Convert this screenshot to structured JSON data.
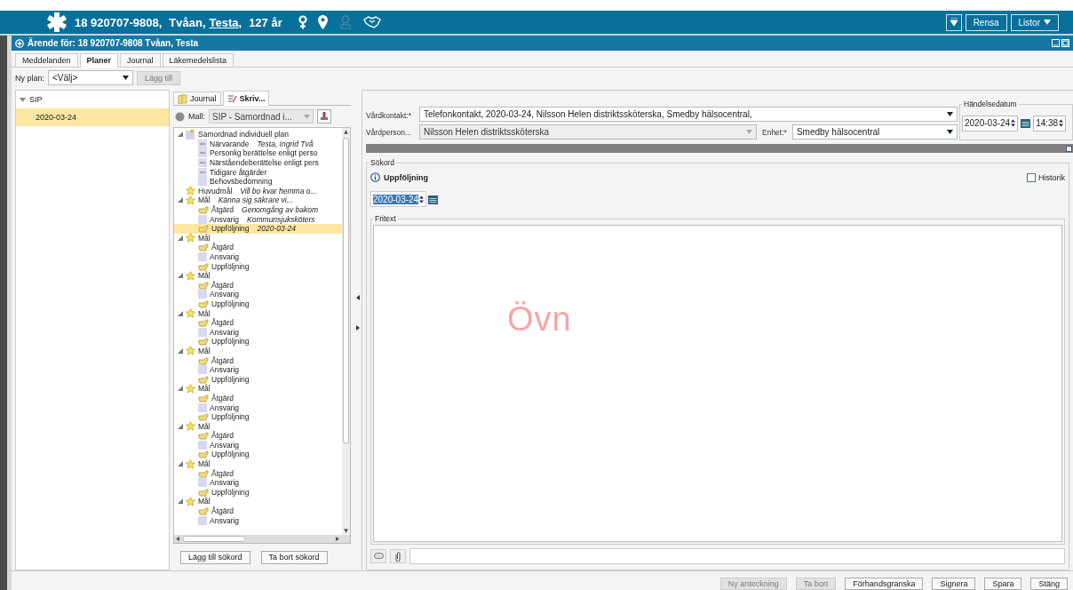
{
  "patient": {
    "id": "18 920707-9808,",
    "surname": "Tvåan,",
    "first_name": "Testa",
    "separator": ",",
    "age": "127 år"
  },
  "header_buttons": [
    {
      "label": "Rensa",
      "kind": "plain"
    },
    {
      "label": "Listor",
      "kind": "menu"
    }
  ],
  "window": {
    "title": "Ärende för: 18 920707-9808 Tvåan, Testa"
  },
  "tabs": [
    {
      "label": "Meddelanden",
      "selected": false
    },
    {
      "label": "Planer",
      "selected": true
    },
    {
      "label": "Journal",
      "selected": false
    },
    {
      "label": "Läkemedelslista",
      "selected": false
    }
  ],
  "new_plan": {
    "label": "Ny plan:",
    "value": "<Välj>",
    "button": "Lägg till",
    "button_disabled": true
  },
  "plans": [
    {
      "label": "SIP",
      "expanded": true,
      "children": [
        {
          "label": "2020-03-24",
          "selected": true
        }
      ]
    }
  ],
  "subtabs": [
    {
      "label": "Journal",
      "kind": "book",
      "selected": false
    },
    {
      "label": "Skriv...",
      "kind": "pen",
      "selected": true
    }
  ],
  "template": {
    "label": "Mall:",
    "value": "SIP - Samordnad i..."
  },
  "tree": [
    {
      "label": "Samordnad individuell plan",
      "kind": "plan",
      "selected": false,
      "expanded": true,
      "children": [
        {
          "label": "Närvarande",
          "value": "Testa, Ingrid Två",
          "kind": "page",
          "selected": false
        },
        {
          "label": "Personlig berättelse enligt perso",
          "kind": "page",
          "selected": false
        },
        {
          "label": "Närståendeberättelse enligt pers",
          "kind": "page",
          "selected": false
        },
        {
          "label": "Tidigare åtgärder",
          "kind": "page",
          "selected": false
        },
        {
          "label": "Behovsbedömning",
          "kind": "box",
          "selected": false
        }
      ]
    },
    {
      "label": "Huvudmål",
      "value": "Vill bo kvar hemma o...",
      "kind": "star",
      "selected": false
    },
    {
      "label": "Mål",
      "value": "Känna sig säkrare vi...",
      "kind": "star",
      "selected": false,
      "expanded": true,
      "children": [
        {
          "label": "Åtgärd",
          "value": "Genomgång av bakom",
          "kind": "hand",
          "selected": false
        },
        {
          "label": "Ansvarig",
          "value": "Kommunsjuksköters",
          "kind": "box",
          "selected": false
        },
        {
          "label": "Uppföljning",
          "value": "2020-03-24",
          "kind": "hand",
          "selected": true
        }
      ]
    },
    {
      "label": "Mål",
      "kind": "star",
      "selected": false,
      "expanded": true,
      "children": [
        {
          "label": "Åtgärd",
          "kind": "hand",
          "selected": false
        },
        {
          "label": "Ansvarig",
          "kind": "box",
          "selected": false
        },
        {
          "label": "Uppföljning",
          "kind": "hand",
          "selected": false
        }
      ]
    },
    {
      "label": "Mål",
      "kind": "star",
      "selected": false,
      "expanded": true,
      "children": [
        {
          "label": "Åtgärd",
          "kind": "hand",
          "selected": false
        },
        {
          "label": "Ansvarig",
          "kind": "box",
          "selected": false
        },
        {
          "label": "Uppföljning",
          "kind": "hand",
          "selected": false
        }
      ]
    },
    {
      "label": "Mål",
      "kind": "star",
      "selected": false,
      "expanded": true,
      "children": [
        {
          "label": "Åtgärd",
          "kind": "hand",
          "selected": false
        },
        {
          "label": "Ansvarig",
          "kind": "box",
          "selected": false
        },
        {
          "label": "Uppföljning",
          "kind": "hand",
          "selected": false
        }
      ]
    },
    {
      "label": "Mål",
      "kind": "star",
      "selected": false,
      "expanded": true,
      "children": [
        {
          "label": "Åtgärd",
          "kind": "hand",
          "selected": false
        },
        {
          "label": "Ansvarig",
          "kind": "box",
          "selected": false
        },
        {
          "label": "Uppföljning",
          "kind": "hand",
          "selected": false
        }
      ]
    },
    {
      "label": "Mål",
      "kind": "star",
      "selected": false,
      "expanded": true,
      "children": [
        {
          "label": "Åtgärd",
          "kind": "hand",
          "selected": false
        },
        {
          "label": "Ansvarig",
          "kind": "box",
          "selected": false
        },
        {
          "label": "Uppföljning",
          "kind": "hand",
          "selected": false
        }
      ]
    },
    {
      "label": "Mål",
      "kind": "star",
      "selected": false,
      "expanded": true,
      "children": [
        {
          "label": "Åtgärd",
          "kind": "hand",
          "selected": false
        },
        {
          "label": "Ansvarig",
          "kind": "box",
          "selected": false
        },
        {
          "label": "Uppföljning",
          "kind": "hand",
          "selected": false
        }
      ]
    },
    {
      "label": "Mål",
      "kind": "star",
      "selected": false,
      "expanded": true,
      "children": [
        {
          "label": "Åtgärd",
          "kind": "hand",
          "selected": false
        },
        {
          "label": "Ansvarig",
          "kind": "box",
          "selected": false
        },
        {
          "label": "Uppföljning",
          "kind": "hand",
          "selected": false
        }
      ]
    },
    {
      "label": "Mål",
      "kind": "star",
      "selected": false,
      "expanded": true,
      "children": [
        {
          "label": "Åtgärd",
          "kind": "hand",
          "selected": false
        },
        {
          "label": "Ansvarig",
          "kind": "box",
          "selected": false
        }
      ]
    }
  ],
  "tree_buttons": [
    "Lägg till sökord",
    "Ta bort sökord"
  ],
  "contact": {
    "label": "Vårdkontakt:*",
    "value": "Telefonkontakt, 2020-03-24, Nilsson Helen distriktssköterska, Smedby hälsocentral,"
  },
  "caregiver": {
    "label": "Vårdperson...",
    "value": "Nilsson Helen distriktssköterska",
    "disabled": true
  },
  "unit": {
    "label": "Enhet:*",
    "value": "Smedby hälsocentral"
  },
  "event_date": {
    "legend": "Händelsedatum",
    "date": "2020-03-24",
    "time": "14:38"
  },
  "keywords": {
    "legend": "Sökord",
    "heading": "Uppföljning",
    "date": "2020-03-24",
    "date_highlighted": true,
    "history": {
      "label": "Historik",
      "checked": false
    },
    "freetext_legend": "Fritext",
    "watermark": "Övn"
  },
  "actions": [
    {
      "label": "Ny anteckning",
      "disabled": true
    },
    {
      "label": "Ta bort",
      "disabled": true
    },
    {
      "label": "Förhandsgranska",
      "disabled": false
    },
    {
      "label": "Signera",
      "disabled": false
    },
    {
      "label": "Spara",
      "disabled": false
    },
    {
      "label": "Stäng",
      "disabled": false
    }
  ]
}
